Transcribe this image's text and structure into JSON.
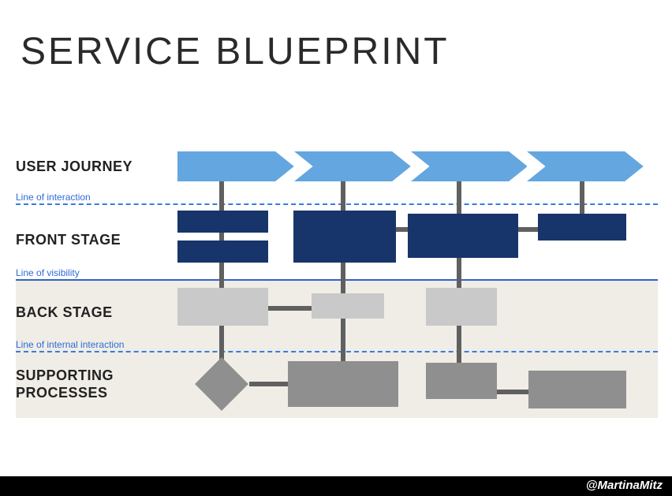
{
  "title": "SERVICE BLUEPRINT",
  "rows": {
    "user_journey": "USER JOURNEY",
    "front_stage": "FRONT STAGE",
    "back_stage": "BACK STAGE",
    "supporting": "SUPPORTING\nPROCESSES"
  },
  "lines": {
    "interaction": "Line of interaction",
    "visibility": "Line of visibility",
    "internal": "Line of internal interaction"
  },
  "colors": {
    "chevron": "#64a6e0",
    "front": "#17356a",
    "back": "#c9c9c9",
    "support": "#8f8f8f",
    "connector": "#606060",
    "band": "#efede6",
    "line_blue": "#3a7bdc"
  },
  "footer": "@MartinaMitz"
}
